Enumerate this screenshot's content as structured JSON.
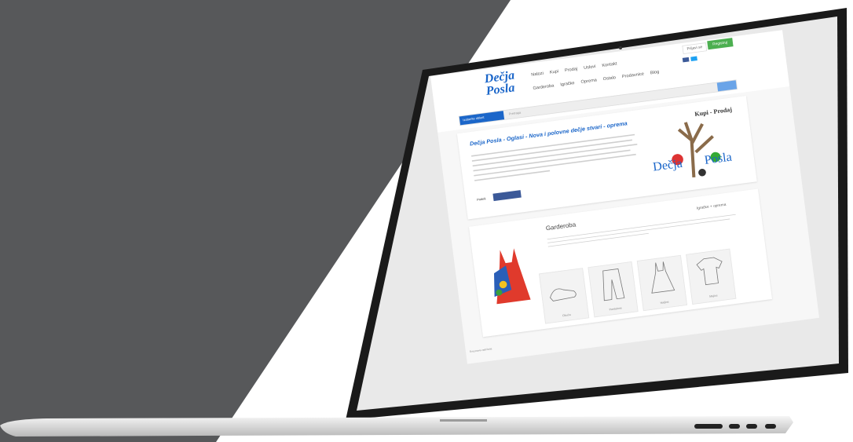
{
  "colors": {
    "dark_panel": "#57585a",
    "brand_blue": "#1b66c9",
    "register_green": "#4caf50",
    "facebook_blue": "#3b5998"
  },
  "header": {
    "logo_line1": "Dečja",
    "logo_line2": "Posla",
    "nav_primary": [
      "Nalozi",
      "Kupi",
      "Prodaj",
      "Uslovi",
      "Kontakt"
    ],
    "nav_secondary": [
      "Garderoba",
      "Igračke",
      "Oprema",
      "Ostalo",
      "Prodavnice",
      "Blog"
    ],
    "login_label": "Prijavi se",
    "register_label": "Registruj",
    "social_icons": [
      "facebook-icon",
      "twitter-icon"
    ]
  },
  "search": {
    "category_label": "Izaberite oblast",
    "placeholder": "Pretraga"
  },
  "hero": {
    "title": "Dečja Posla - Oglasi - Nova i polovne dečje stvari - oprema",
    "share_label": "Podeli",
    "art_caption_top": "Kupi - Prodaj",
    "art_word1": "Dečja",
    "art_word2": "Posla"
  },
  "category_card": {
    "title": "Garderoba",
    "link": "Igračke + oprema",
    "tiles": [
      "Obuća",
      "Pantalone",
      "Haljine",
      "Majice"
    ]
  },
  "footer": {
    "note": "Sva prava zadržana"
  }
}
